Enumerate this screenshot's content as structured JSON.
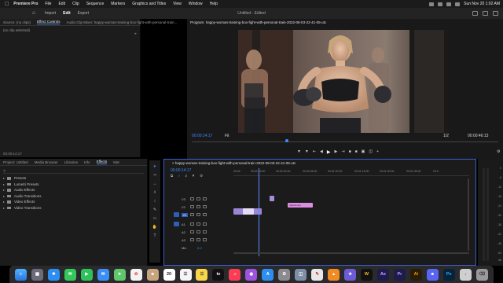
{
  "menubar": {
    "apple": "",
    "app_name": "Premiere Pro",
    "items": [
      "File",
      "Edit",
      "Clip",
      "Sequence",
      "Markers",
      "Graphics and Titles",
      "View",
      "Window",
      "Help"
    ],
    "clock": "Sun Nov 20  1:02 AM"
  },
  "header": {
    "tabs": [
      "Import",
      "Edit",
      "Export"
    ],
    "active_tab": "Edit",
    "document_title": "Untitled  -  Edited"
  },
  "source_panel": {
    "tabs": [
      "Source: (no clips)",
      "Effect Controls",
      "Audio Clip Mixer: happy-woman-training-box-fight-with-personal-train..."
    ],
    "active_tab": "Effect Controls",
    "no_clip_text": "(no clip selected)",
    "timecode": "00:00:14:17"
  },
  "program_panel": {
    "title": "Program: happy-woman-training-box-fight-with-personal-train-2022-08-03-22-41-05-utc",
    "current_timecode": "00:00:14:17",
    "fit": "Fit",
    "quality": "1/2",
    "duration_timecode": "00:00:46:13"
  },
  "effects_panel": {
    "tabs": [
      "Project: Untitled",
      "Media Browser",
      "Libraries",
      "Info",
      "Effects",
      "Mar"
    ],
    "active_tab": "Effects",
    "search_icon": "search-icon",
    "items": [
      {
        "label": "Presets"
      },
      {
        "label": "Lumetri Presets"
      },
      {
        "label": "Audio Effects"
      },
      {
        "label": "Audio Transitions"
      },
      {
        "label": "Video Effects"
      },
      {
        "label": "Video Transitions"
      }
    ]
  },
  "timeline": {
    "sequence_name": "happy-woman-training-box-fight-with-personal-train-2022-08-03-22-41-05-utc",
    "timecode": "00:00:14:17",
    "ruler_ticks": [
      "00:00",
      "00:00:15:00",
      "00:00:30:00",
      "00:00:45:00",
      "00:01:00:00",
      "00:01:15:00",
      "00:01:30:00",
      "00:01:45:00",
      "00:0"
    ],
    "tracks": [
      {
        "label": "V3"
      },
      {
        "label": "V2"
      },
      {
        "label": "V1"
      },
      {
        "label": "A1"
      },
      {
        "label": "A2"
      },
      {
        "label": "A3"
      },
      {
        "label": "Mix",
        "value": "0.0"
      }
    ],
    "adjustment_clip_label": "Adjustment"
  },
  "meter": {
    "db_labels": [
      "0",
      "-6",
      "-12",
      "-18",
      "-24",
      "-30",
      "-36",
      "-42",
      "-48",
      "-54",
      "dB"
    ]
  },
  "dock": {
    "items": [
      "finder-icon",
      "launchpad-icon",
      "safari-icon",
      "messages-icon",
      "facetime-icon",
      "mail-icon",
      "maps-icon",
      "photos-icon",
      "contacts-icon",
      "calendar-icon",
      "reminders-icon",
      "notes-icon",
      "appletv-icon",
      "music-icon",
      "podcasts-icon",
      "appstore-icon",
      "settings-icon",
      "preview-icon",
      "textedit-icon",
      "vlc-icon",
      "imovie-icon",
      "word-icon",
      "trash-icon"
    ],
    "labels": {
      "calendar": "20",
      "after_effects": "Ae",
      "premiere": "Pr",
      "illustrator": "Ai",
      "photoshop": "Ps",
      "appletv": "tv"
    }
  }
}
